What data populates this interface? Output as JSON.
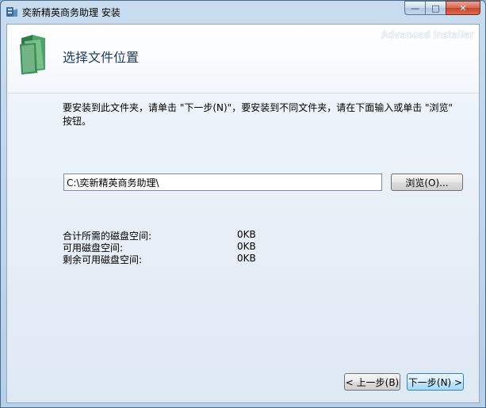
{
  "window": {
    "title": "奕新精英商务助理 安装",
    "controls": {
      "minimize": "—",
      "maximize": "□",
      "close": "✕"
    }
  },
  "header": {
    "page_title": "选择文件位置",
    "watermark": "Advanced Installer"
  },
  "description": "要安装到此文件夹，请单击 \"下一步(N)\"，要安装到不同文件夹，请在下面输入或单击 \"浏览\" 按钮。",
  "install_path": {
    "value": "C:\\奕新精英商务助理\\"
  },
  "buttons": {
    "browse": "浏览(O)...",
    "back": "< 上一步(B)",
    "next": "下一步(N) >"
  },
  "disk_space": [
    {
      "label": "合计所需的磁盘空间:",
      "value": "0KB"
    },
    {
      "label": "可用磁盘空间:",
      "value": "0KB"
    },
    {
      "label": "剩余可用磁盘空间:",
      "value": "0KB"
    }
  ]
}
